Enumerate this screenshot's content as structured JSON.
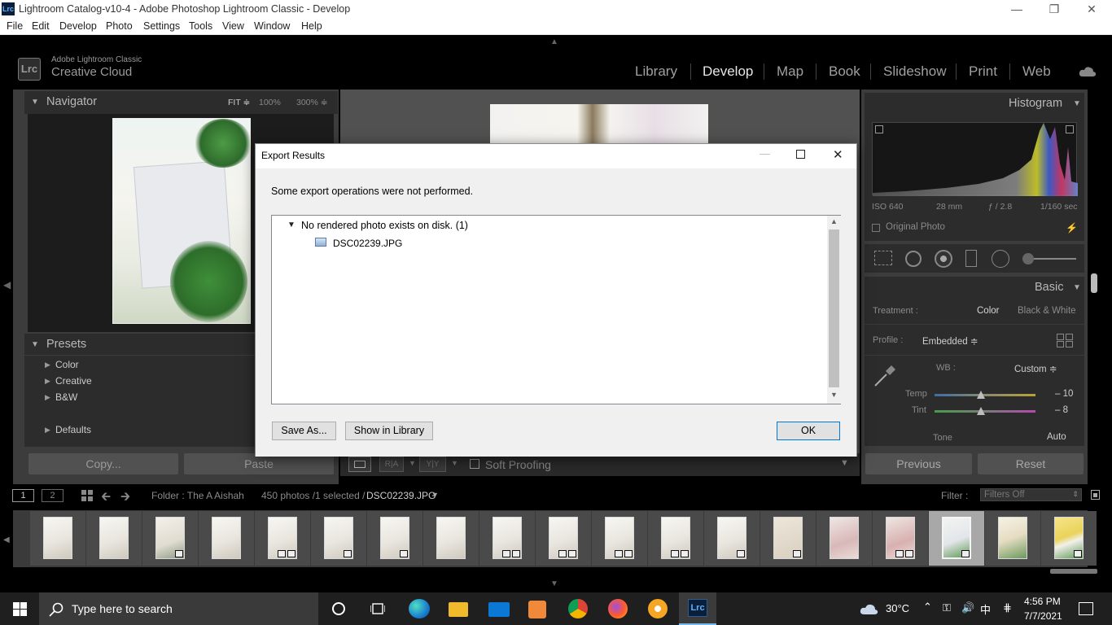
{
  "window": {
    "title": "Lightroom Catalog-v10-4 - Adobe Photoshop Lightroom Classic - Develop",
    "app_badge": "Lrc"
  },
  "menu": [
    "File",
    "Edit",
    "Develop",
    "Photo",
    "Settings",
    "Tools",
    "View",
    "Window",
    "Help"
  ],
  "brand": {
    "logo": "Lrc",
    "line1": "Adobe Lightroom Classic",
    "line2": "Creative Cloud"
  },
  "modules": [
    "Library",
    "Develop",
    "Map",
    "Book",
    "Slideshow",
    "Print",
    "Web"
  ],
  "active_module": "Develop",
  "navigator": {
    "title": "Navigator",
    "fit": "FIT ≑",
    "z100": "100%",
    "z300": "300% ≑"
  },
  "presets": {
    "title": "Presets",
    "items": [
      "Color",
      "Creative",
      "B&W",
      "Defaults"
    ]
  },
  "left_buttons": {
    "copy": "Copy...",
    "paste": "Paste"
  },
  "histogram": {
    "title": "Histogram",
    "iso": "ISO 640",
    "focal": "28 mm",
    "aperture": "ƒ / 2.8",
    "shutter": "1/160 sec",
    "original_photo": "Original Photo"
  },
  "basic": {
    "title": "Basic",
    "treatment_label": "Treatment :",
    "treatment_color": "Color",
    "treatment_bw": "Black & White",
    "profile_label": "Profile :",
    "profile_value": "Embedded ≑",
    "wb_label": "WB :",
    "wb_value": "Custom ≑",
    "temp_label": "Temp",
    "temp_value": "– 10",
    "tint_label": "Tint",
    "tint_value": "– 8",
    "tone_label": "Tone",
    "auto": "Auto"
  },
  "right_buttons": {
    "previous": "Previous",
    "reset": "Reset"
  },
  "toolbar": {
    "soft_proofing": "Soft Proofing"
  },
  "filmbar": {
    "page1": "1",
    "page2": "2",
    "folder": "Folder : The A Aishah",
    "count": "450 photos /1 selected /",
    "filename": "DSC02239.JPG",
    "filter_label": "Filter :",
    "filter_value": "Filters Off"
  },
  "dialog": {
    "title": "Export Results",
    "message": "Some export operations were not performed.",
    "group": "No rendered photo exists on disk. (1)",
    "file": "DSC02239.JPG",
    "save_as": "Save As...",
    "show_in_library": "Show in Library",
    "ok": "OK"
  },
  "taskbar": {
    "search_placeholder": "Type here to search",
    "weather": "30°C",
    "time": "4:56 PM",
    "date": "7/7/2021"
  }
}
